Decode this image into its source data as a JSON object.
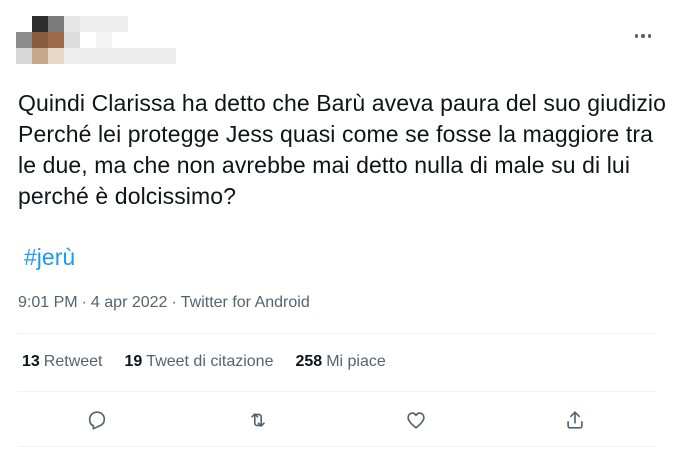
{
  "tweet": {
    "text": "Quindi Clarissa ha detto che Barù aveva paura del suo giudizio Perché lei protegge Jess quasi come se fosse la maggiore tra le due, ma che non avrebbe mai detto nulla di male su di lui perché è dolcissimo?",
    "hashtag": "#jerù",
    "time": "9:01 PM",
    "separator": "·",
    "date": "4 apr 2022",
    "source": "Twitter for Android"
  },
  "stats": {
    "retweets": {
      "count": "13",
      "label": "Retweet"
    },
    "quotes": {
      "count": "19",
      "label": "Tweet di citazione"
    },
    "likes": {
      "count": "258",
      "label": "Mi piace"
    }
  },
  "icons": {
    "more": "more-horizontal-icon",
    "reply": "reply-icon",
    "retweet": "retweet-icon",
    "like": "heart-icon",
    "share": "share-icon"
  },
  "colors": {
    "text": "#0f1419",
    "secondary": "#536471",
    "link": "#1d9bf0",
    "divider": "#eff3f4"
  }
}
